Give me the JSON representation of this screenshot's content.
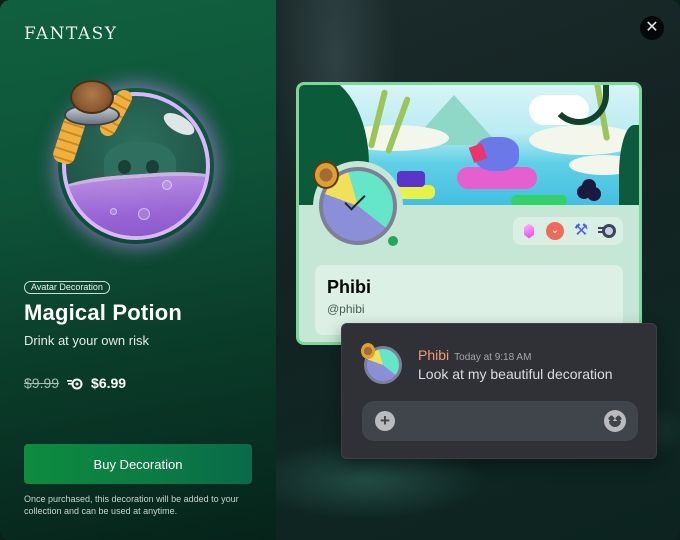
{
  "brand": {
    "logo_text": "FANTASY"
  },
  "product": {
    "category_tag": "Avatar Decoration",
    "name": "Magical Potion",
    "tagline": "Drink at your own risk",
    "original_price": "$9.99",
    "nitro_price": "$6.99",
    "buy_label": "Buy Decoration",
    "disclaimer": "Once purchased, this decoration will be added to your collection and can be used at anytime."
  },
  "close": {
    "label": "✕"
  },
  "profile": {
    "display_name": "Phibi",
    "username": "@phibi",
    "status": "online",
    "badges": [
      "hypesquad-gem",
      "quest",
      "developer-tools",
      "nitro"
    ]
  },
  "message": {
    "author": "Phibi",
    "timestamp": "Today at 9:18 AM",
    "text": "Look at my beautiful decoration",
    "composer_plus": "+"
  },
  "colors": {
    "brand_green": "#0e8c3f",
    "author_color": "#f09a7c",
    "online_status": "#23a55a",
    "profile_border": "#7fd69a",
    "message_bg": "#2f3136"
  }
}
